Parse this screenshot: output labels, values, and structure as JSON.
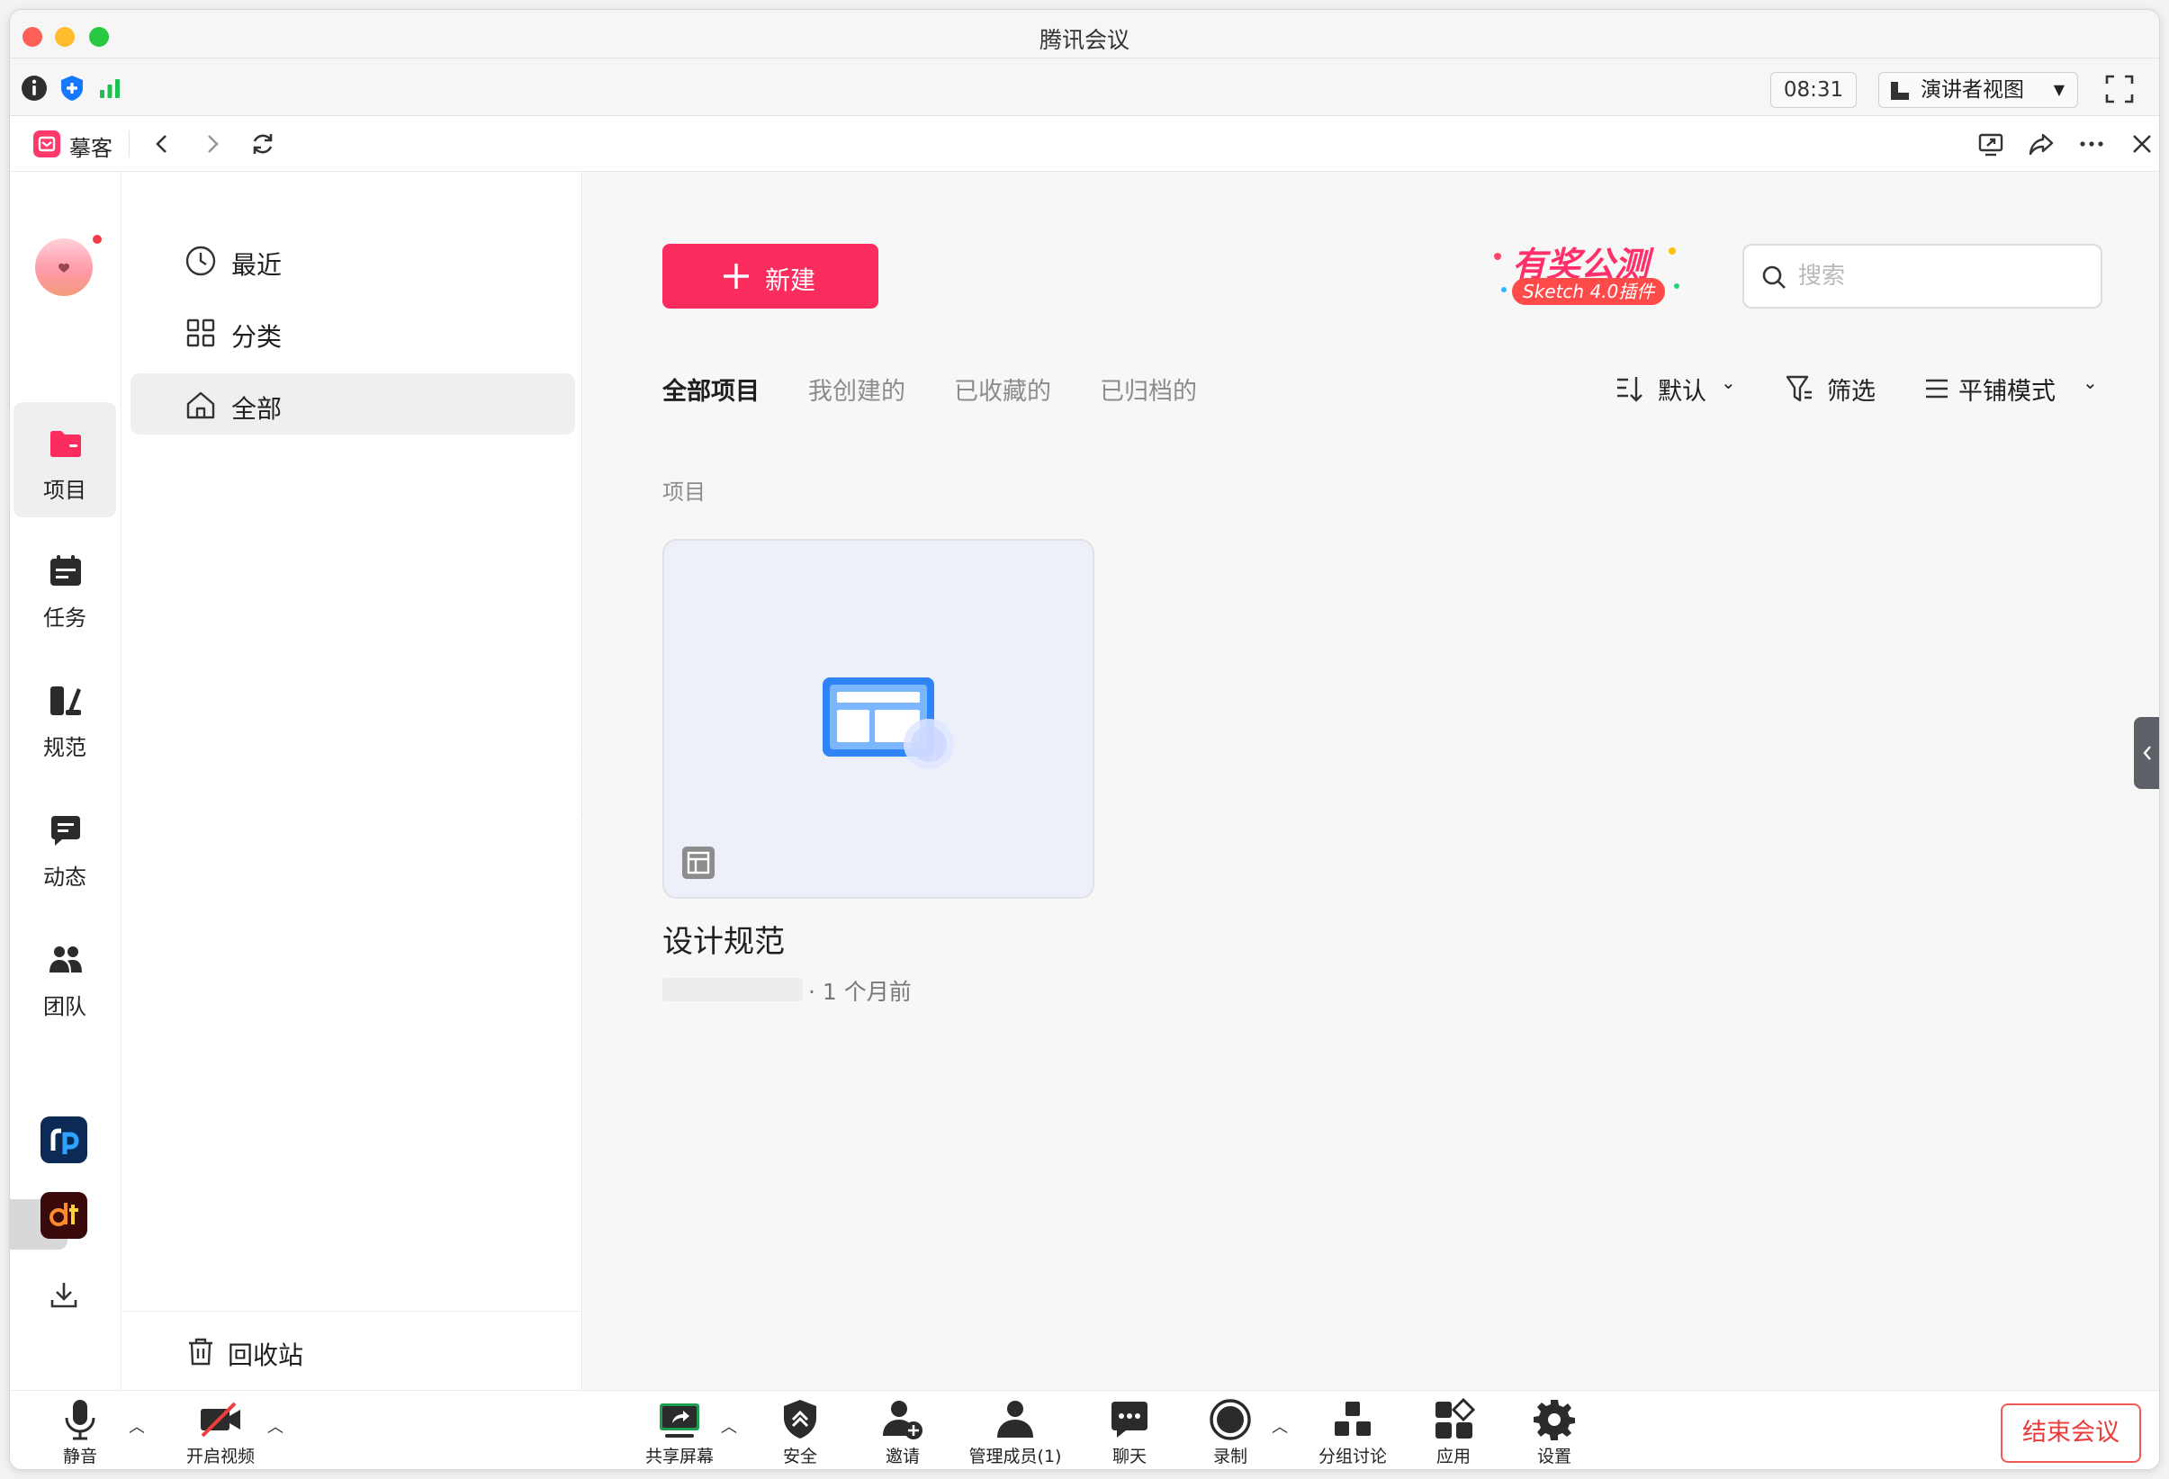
{
  "window": {
    "title": "腾讯会议"
  },
  "meeting_toolbar": {
    "timer": "08:31",
    "view_mode": "演讲者视图"
  },
  "browser": {
    "app_name": "摹客"
  },
  "rail": {
    "items": [
      {
        "label": "项目"
      },
      {
        "label": "任务"
      },
      {
        "label": "规范"
      },
      {
        "label": "动态"
      },
      {
        "label": "团队"
      }
    ]
  },
  "sidebar": {
    "items": [
      {
        "label": "最近"
      },
      {
        "label": "分类"
      },
      {
        "label": "全部"
      }
    ],
    "trash_label": "回收站"
  },
  "main": {
    "new_button_label": "新建",
    "promo": {
      "title": "有奖公测",
      "subtitle": "Sketch 4.0插件"
    },
    "search": {
      "placeholder": "搜索",
      "value": ""
    },
    "tabs": [
      {
        "label": "全部项目"
      },
      {
        "label": "我创建的"
      },
      {
        "label": "已收藏的"
      },
      {
        "label": "已归档的"
      }
    ],
    "tools": {
      "sort_label": "默认",
      "filter_label": "筛选",
      "view_label": "平铺模式"
    },
    "section_label": "项目",
    "projects": [
      {
        "name": "设计规范",
        "time": "· 1 个月前"
      }
    ]
  },
  "bottom_bar": {
    "mute": "静音",
    "video": "开启视频",
    "share": "共享屏幕",
    "security": "安全",
    "invite": "邀请",
    "members": "管理成员(1)",
    "chat": "聊天",
    "record": "录制",
    "breakout": "分组讨论",
    "apps": "应用",
    "settings": "设置",
    "end_meeting": "结束会议"
  },
  "colors": {
    "accent": "#fb2c5e",
    "end_meeting": "#ea3b3b",
    "card_bg": "#eef0f9"
  }
}
